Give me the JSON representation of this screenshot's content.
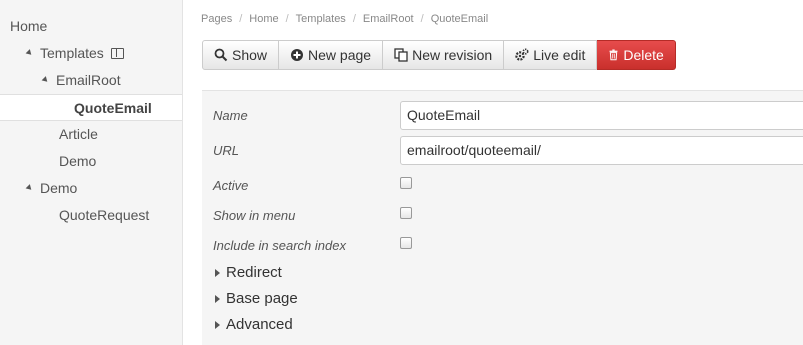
{
  "sidebar": {
    "items": [
      {
        "label": "Home"
      },
      {
        "label": "Templates"
      },
      {
        "label": "EmailRoot"
      },
      {
        "label": "QuoteEmail"
      },
      {
        "label": "Article"
      },
      {
        "label": "Demo"
      },
      {
        "label": "Demo"
      },
      {
        "label": "QuoteRequest"
      }
    ]
  },
  "breadcrumb": [
    "Pages",
    "Home",
    "Templates",
    "EmailRoot",
    "QuoteEmail"
  ],
  "toolbar": {
    "show": "Show",
    "new_page": "New page",
    "new_revision": "New revision",
    "live_edit": "Live edit",
    "delete": "Delete"
  },
  "form": {
    "name_label": "Name",
    "name_value": "QuoteEmail",
    "url_label": "URL",
    "url_value": "emailroot/quoteemail/",
    "active_label": "Active",
    "show_in_menu_label": "Show in menu",
    "include_search_label": "Include in search index",
    "sections": [
      "Redirect",
      "Base page",
      "Advanced"
    ]
  },
  "colors": {
    "delete_button": "#d9534f",
    "sidebar_bg": "#f5f5f5"
  },
  "icons": [
    "search-icon",
    "plus-circle-icon",
    "copy-icon",
    "cogs-icon",
    "trash-icon",
    "template-icon"
  ]
}
